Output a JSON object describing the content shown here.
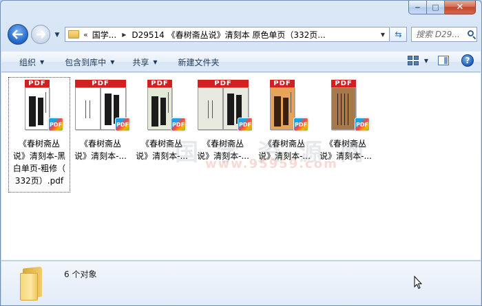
{
  "window": {
    "caption": {
      "minimize": "‒",
      "maximize": "□",
      "close": "✕"
    }
  },
  "address": {
    "overflow": "«",
    "crumbs": [
      "国学...",
      "D29514 《春树斋丛说》清刻本 原色单页（332页..."
    ],
    "search_placeholder": "搜索 D29..."
  },
  "toolbar": {
    "organize": "组织",
    "include_in_library": "包含到库中",
    "share": "共享",
    "new_folder": "新建文件夹"
  },
  "files": [
    {
      "lines": [
        "《春树斋丛",
        "说》清刻本-黑",
        "白单页-粗修（",
        "332页）.pdf"
      ],
      "tab": "PDF",
      "badge": "PDF",
      "page_color": "#ffffff"
    },
    {
      "lines": [
        "《春树斋丛",
        "说》清刻本-..."
      ],
      "tab": "PDF",
      "badge": "PDF",
      "page_color": "#ffffff"
    },
    {
      "lines": [
        "《春树斋丛",
        "说》清刻本-..."
      ],
      "tab": "PDF",
      "badge": "PDF",
      "page_color": "#e3ead8"
    },
    {
      "lines": [
        "《春树斋丛",
        "说》清刻本-..."
      ],
      "tab": "PDF",
      "badge": "PDF",
      "page_color": "#e8eadf"
    },
    {
      "lines": [
        "《春树斋丛",
        "说》清刻本-..."
      ],
      "tab": "PDF",
      "badge": "PDF",
      "page_color": "#e8a35a"
    },
    {
      "lines": [
        "《春树斋丛",
        "说》清刻本-..."
      ],
      "tab": "PDF",
      "badge": "PDF",
      "page_color": "#a7784a"
    }
  ],
  "watermark": {
    "chars": "国学资源网",
    "number": "www.95959.com"
  },
  "details": {
    "count": "6 个对象"
  },
  "colors": {
    "accent": "#1e395b",
    "pdf_red": "#d02020"
  }
}
